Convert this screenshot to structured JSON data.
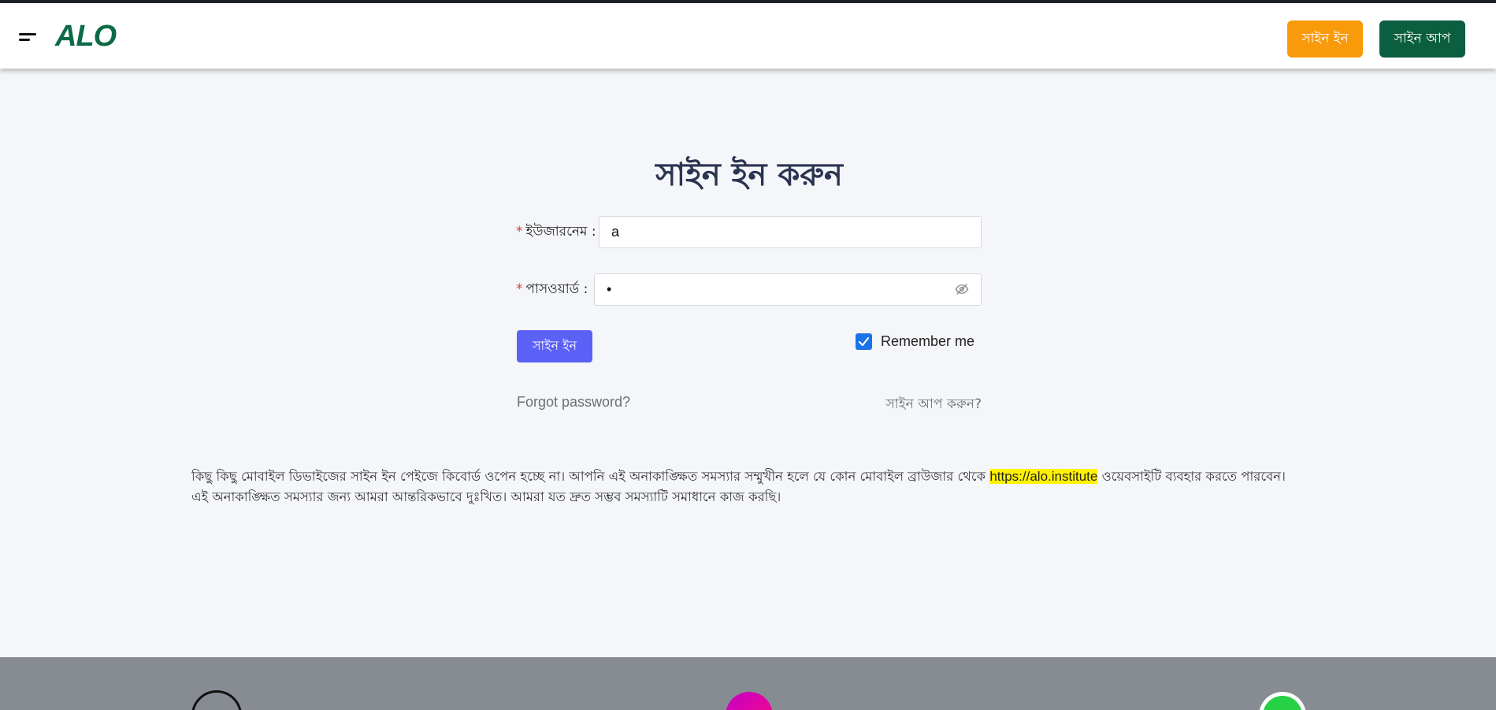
{
  "header": {
    "logo_text": "ALO",
    "signin_label": "সাইন ইন",
    "signup_label": "সাইন আপ",
    "accent_signin": "#f99a0b",
    "accent_signup": "#0b5e3f"
  },
  "form": {
    "title": "সাইন ইন করুন",
    "username_label": "ইউজারনেম :",
    "username_value": "a",
    "password_label": "পাসওয়ার্ড :",
    "password_value": "•",
    "submit_label": "সাইন ইন",
    "remember_label": "Remember me",
    "remember_checked": true,
    "forgot_label": "Forgot password?",
    "signup_prompt": "সাইন আপ করুন?"
  },
  "notice": {
    "before": "কিছু কিছু মোবাইল ডিভাইজের সাইন ইন পেইজে কিবোর্ড ওপেন হচ্ছে না। আপনি এই অনাকাঙ্ক্ষিত সমস্যার সম্মুখীন হলে যে কোন মোবাইল ব্রাউজার থেকে ",
    "url": "https://alo.institute",
    "after": " ওয়েবসাইটি ব্যবহার করতে পারবেন। এই অনাকাঙ্ক্ষিত সমস্যার জন্য আমরা আন্তরিকভাবে দুঃখিত। আমরা যত দ্রুত সম্ভব সমস্যাটি সমাধানে কাজ করছি।"
  },
  "footer": {
    "icons": [
      "threads-icon",
      "messenger-icon",
      "whatsapp-icon"
    ]
  }
}
